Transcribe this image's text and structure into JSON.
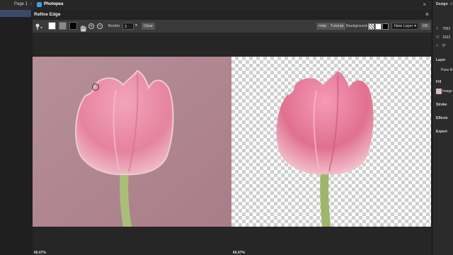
{
  "topbar": {
    "page_tab": "Page 1",
    "page_chevron": "›"
  },
  "app_tab": {
    "title": "Photopea",
    "close": "×"
  },
  "right_panel": {
    "tab_design": "Design",
    "tab_extra": "A",
    "x_label": "X",
    "x_value": "7062",
    "w_label": "W",
    "w_value": "1632",
    "rot_label": "↻",
    "rot_value": "0°",
    "layer_heading": "Layer",
    "layer_mode": "Pass th",
    "fill_heading": "Fill",
    "fill_value": "Image",
    "stroke_heading": "Stroke",
    "effects_heading": "Effects",
    "export_heading": "Export",
    "fill_swatch_color": "#e0b9c5"
  },
  "dialog": {
    "title": "Refine Edge",
    "close": "×",
    "toolbar": {
      "brush_icon": "brush-icon",
      "hand_icon": "hand-icon",
      "plus": "+",
      "minus": "−",
      "border_label": "Border",
      "border_value": "3",
      "dropdown_arrow": "▾",
      "clear_label": "Clear",
      "help_label": "Help",
      "tutorial_label": "Tutorial",
      "background_label": "Background:",
      "output_select": "New Layer",
      "ok_label": "OK"
    },
    "left_zoom": "66.67%",
    "right_zoom": "66.67%"
  }
}
